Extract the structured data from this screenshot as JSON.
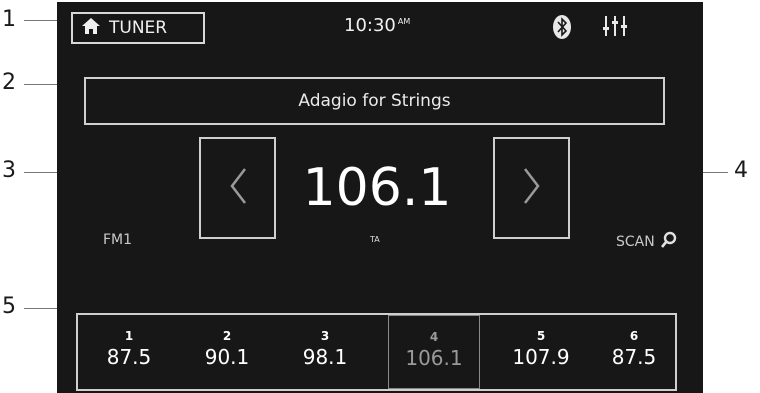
{
  "callouts": [
    "1",
    "2",
    "3",
    "4",
    "5"
  ],
  "header": {
    "source_label": "TUNER",
    "time": "10:30",
    "ampm": "AM"
  },
  "station_text": "Adagio for Strings",
  "tuner": {
    "frequency": "106.1",
    "ta_label": "TA",
    "band": "FM1",
    "scan_label": "SCAN"
  },
  "presets": [
    {
      "number": "1",
      "frequency": "87.5",
      "active": false
    },
    {
      "number": "2",
      "frequency": "90.1",
      "active": false
    },
    {
      "number": "3",
      "frequency": "98.1",
      "active": false
    },
    {
      "number": "4",
      "frequency": "106.1",
      "active": true
    },
    {
      "number": "5",
      "frequency": "107.9",
      "active": false
    },
    {
      "number": "6",
      "frequency": "87.5",
      "active": false
    }
  ],
  "colors": {
    "screen_bg": "#171717",
    "active_preset": "#9a9a9a"
  },
  "icons": [
    "home-icon",
    "bluetooth-icon",
    "equalizer-icon",
    "chevron-left-icon",
    "chevron-right-icon",
    "search-icon"
  ]
}
